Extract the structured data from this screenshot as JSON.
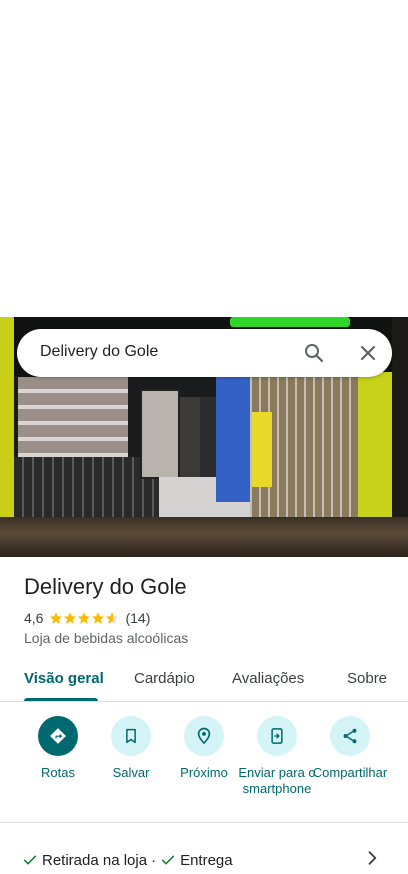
{
  "search": {
    "query": "Delivery do Gole"
  },
  "place": {
    "name": "Delivery do Gole",
    "rating": "4,6",
    "rating_value": 4.6,
    "reviews_count": "(14)",
    "category": "Loja de bebidas alcoólicas"
  },
  "tabs": [
    {
      "label": "Visão geral",
      "active": true
    },
    {
      "label": "Cardápio"
    },
    {
      "label": "Avaliações"
    },
    {
      "label": "Sobre"
    }
  ],
  "actions": [
    {
      "label": "Rotas",
      "icon": "directions-icon"
    },
    {
      "label": "Salvar",
      "icon": "bookmark-icon"
    },
    {
      "label": "Próximo",
      "icon": "nearby-icon"
    },
    {
      "label": "Enviar para o smartphone",
      "icon": "send-to-phone-icon"
    },
    {
      "label": "Compartilhar",
      "icon": "share-icon"
    }
  ],
  "options": {
    "pickup": "Retirada na loja",
    "separator": "·",
    "delivery": "Entrega"
  },
  "colors": {
    "accent": "#00696f",
    "action_bg": "#d4f4f8",
    "star": "#fbbc04",
    "check": "#188038"
  }
}
